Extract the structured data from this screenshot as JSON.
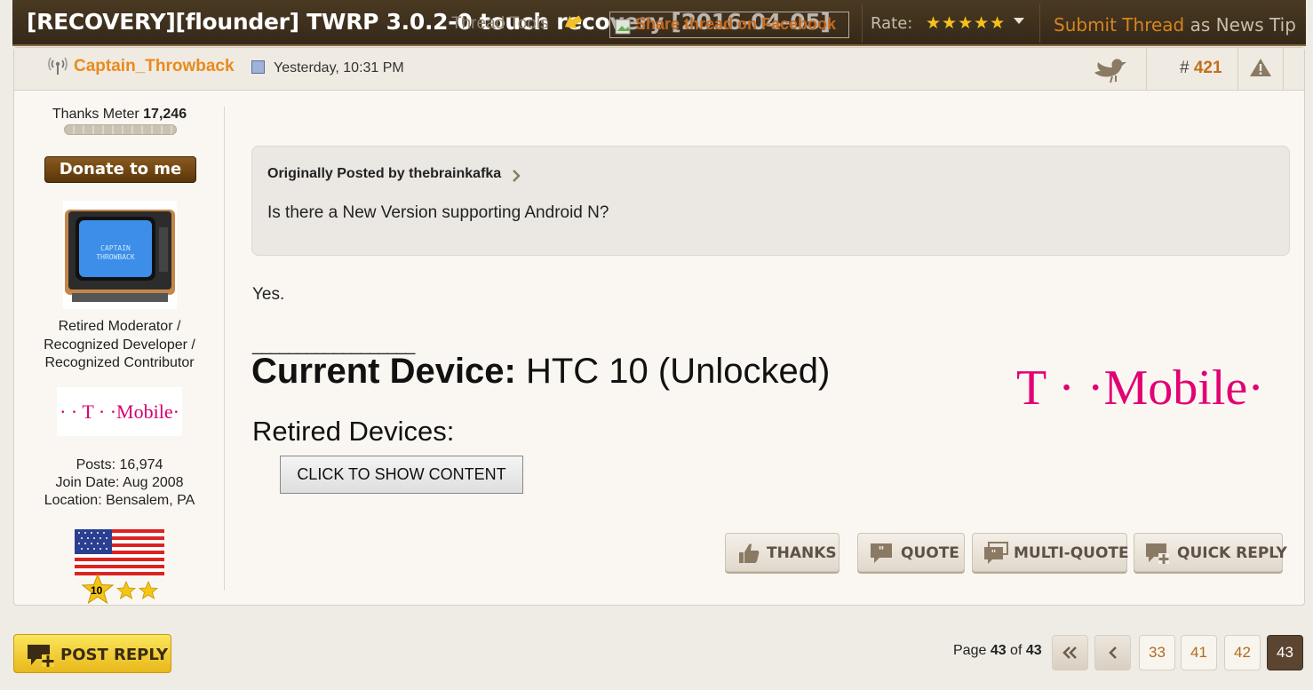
{
  "topbar": {
    "thread_title": "[RECOVERY][flounder] TWRP 3.0.2-0 touch recovery [2016-04-05]",
    "thread_tools": "Thread Tools",
    "share_facebook": "Share thread on Facebook",
    "rate_label": "Rate:",
    "rate_stars": "★★★★★",
    "submit_tip_part1": "Submit Thread",
    "submit_tip_part2": " as News Tip"
  },
  "post": {
    "author": "Captain_Throwback",
    "date": "Yesterday, 10:31 PM",
    "number_prefix": "#",
    "number": "421",
    "quote": {
      "attribution": "Originally Posted by thebrainkafka",
      "text": "Is there a New Version supporting Android N?"
    },
    "body": "Yes.",
    "signature": {
      "line": "__________________",
      "current_label": "Current Device:",
      "current_value": " HTC 10 (Unlocked)",
      "retired_label": "Retired Devices:",
      "show_content_button": "CLICK TO SHOW CONTENT",
      "brand_logo_text": "T · ·Mobile·"
    },
    "actions": {
      "thanks": "THANKS",
      "quote": "QUOTE",
      "multi_quote": "MULTI-QUOTE",
      "quick_reply": "QUICK REPLY"
    }
  },
  "user": {
    "thanks_label": "Thanks Meter",
    "thanks_value": "17,246",
    "donate": "Donate to me",
    "title_line1": "Retired Moderator /",
    "title_line2": "Recognized Developer /",
    "title_line3": "Recognized Contributor",
    "carrier_logo_text": "· · T · ·Mobile·",
    "posts": "Posts: 16,974",
    "join_date": "Join Date: Aug 2008",
    "location": "Location: Bensalem, PA",
    "rep_star_number": "10"
  },
  "footer": {
    "post_reply": "POST REPLY",
    "page_prefix": "Page ",
    "page_current": "43",
    "page_of": " of ",
    "page_total": "43",
    "pages": [
      "33",
      "41",
      "42",
      "43"
    ]
  },
  "colors": {
    "accent_orange": "#e98a1c",
    "tmobile_magenta": "#e20074",
    "topbar_brown": "#35281a"
  }
}
